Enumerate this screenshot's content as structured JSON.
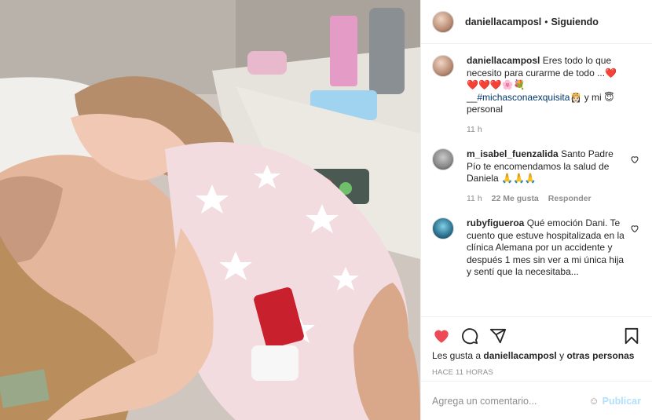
{
  "post": {
    "image_alt": "Foto de una niña besando a su madre en una cama de hospital",
    "header": {
      "username": "daniellacamposl",
      "dot": "•",
      "follow_label": "Siguiendo"
    },
    "comments": [
      {
        "username": "daniellacamposl",
        "text_parts": [
          "Eres todo lo que necesito para curarme de todo ...",
          "❤️",
          " ",
          "❤️❤️❤️🌸💐",
          " __",
          "#michasconaexquisita",
          "👸🏻",
          " y mi ",
          "😇",
          " personal"
        ],
        "time": "11 h"
      },
      {
        "username": "m_isabel_fuenzalida",
        "text": "Santo Padre Pío te encomendamos la salud de Daniela 🙏🙏🙏",
        "time": "11 h",
        "likes": "22 Me gusta",
        "reply_label": "Responder"
      },
      {
        "username": "rubyfigueroa",
        "text": "Qué emoción Dani. Te cuento que estuve hospitalizada en la clínica Alemana por un accidente y después 1 mes sin ver a mi única hija y sentí que la necesitaba..."
      }
    ],
    "likes": {
      "prefix": "Les gusta a ",
      "user": "daniellacamposl",
      "middle": " y ",
      "others": "otras personas"
    },
    "timestamp": "HACE 11 HORAS",
    "composer": {
      "placeholder": "Agrega un comentario...",
      "emoji": "☺",
      "publish_label": "Publicar"
    },
    "colors": {
      "liked_heart": "#ed4956",
      "link": "#00376b",
      "publish_disabled": "#b2dffc",
      "muted": "#8e8e8e"
    }
  }
}
